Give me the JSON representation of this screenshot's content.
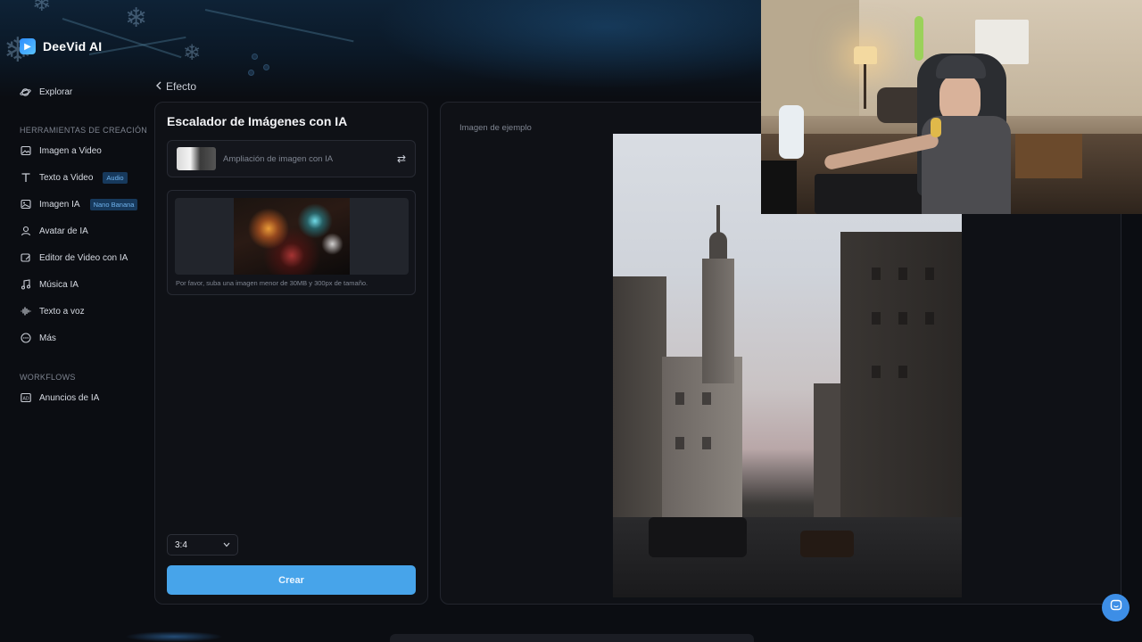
{
  "brand": {
    "name": "DeeVid AI"
  },
  "sidebar": {
    "explore": "Explorar",
    "section_tools": "HERRAMIENTAS DE CREACIÓN",
    "items": [
      {
        "label": "Imagen a Video",
        "icon": "image-icon",
        "badge": ""
      },
      {
        "label": "Texto a Video",
        "icon": "text-icon",
        "badge": "Audio"
      },
      {
        "label": "Imagen IA",
        "icon": "image-ai-icon",
        "badge": "Nano Banana"
      },
      {
        "label": "Avatar de IA",
        "icon": "avatar-icon",
        "badge": ""
      },
      {
        "label": "Editor de Video con IA",
        "icon": "edit-icon",
        "badge": ""
      },
      {
        "label": "Música IA",
        "icon": "music-icon",
        "badge": ""
      },
      {
        "label": "Texto a voz",
        "icon": "waveform-icon",
        "badge": ""
      },
      {
        "label": "Más",
        "icon": "more-icon",
        "badge": ""
      }
    ],
    "section_workflows": "WORKFLOWS",
    "workflow_items": [
      {
        "label": "Anuncios de IA",
        "icon": "ad-icon"
      }
    ]
  },
  "back": {
    "label": "Efecto"
  },
  "tool": {
    "title": "Escalador de Imágenes con IA",
    "effect_label": "Ampliación de imagen con IA",
    "upload_hint": "Por favor, suba una imagen menor de 30MB y 300px de tamaño.",
    "ratio": "3:4",
    "create_label": "Crear"
  },
  "preview": {
    "label": "Imagen de ejemplo"
  },
  "colors": {
    "accent": "#47a4ea",
    "badge_bg": "#17395c",
    "badge_text": "#6fb2ec"
  }
}
